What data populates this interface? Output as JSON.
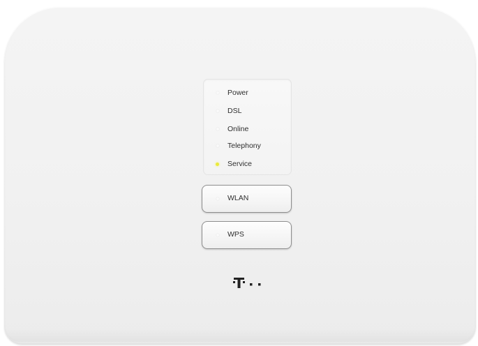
{
  "router": {
    "status_leds": [
      {
        "label": "Power",
        "state": "off"
      },
      {
        "label": "DSL",
        "state": "off"
      },
      {
        "label": "Online",
        "state": "off"
      },
      {
        "label": "Telephony",
        "state": "off"
      },
      {
        "label": "Service",
        "state": "on",
        "color": "#eaea3a"
      }
    ],
    "buttons": [
      {
        "label": "WLAN",
        "led_state": "off"
      },
      {
        "label": "WPS",
        "led_state": "off"
      }
    ]
  },
  "colors": {
    "body": "#f2f2f2",
    "led_off": "#fafafa",
    "led_service": "#eaea3a",
    "text": "#2e2e2e",
    "logo": "#222222"
  },
  "logo": {
    "icon": "telekom-t-logo"
  }
}
